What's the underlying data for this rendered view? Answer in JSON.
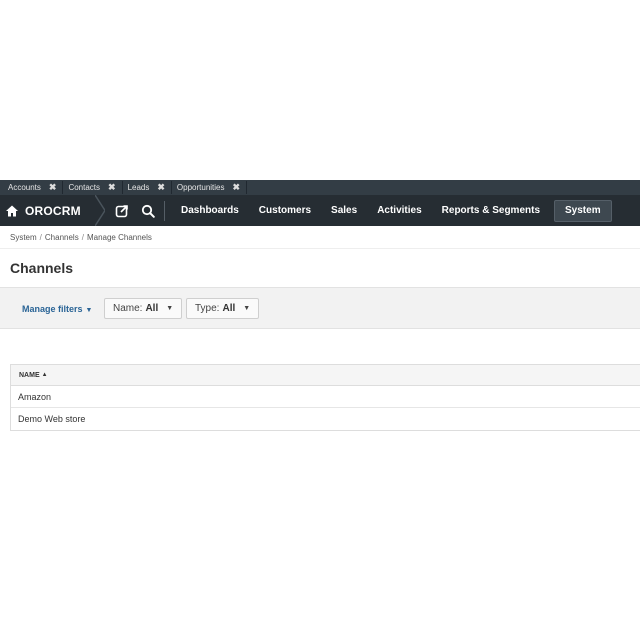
{
  "pinbar": {
    "tabs": [
      {
        "label": "Accounts"
      },
      {
        "label": "Contacts"
      },
      {
        "label": "Leads"
      },
      {
        "label": "Opportunities"
      }
    ],
    "close_glyph": "✖"
  },
  "nav": {
    "brand": "OROCRM",
    "items": [
      {
        "label": "Dashboards"
      },
      {
        "label": "Customers"
      },
      {
        "label": "Sales"
      },
      {
        "label": "Activities"
      },
      {
        "label": "Reports & Segments"
      },
      {
        "label": "System"
      }
    ],
    "active": "System",
    "icons": [
      "home-icon",
      "share-icon",
      "search-icon"
    ]
  },
  "breadcrumb": [
    "System",
    "Channels",
    "Manage Channels"
  ],
  "page_title": "Channels",
  "filters": {
    "manage_label": "Manage filters",
    "name_filter": {
      "label": "Name:",
      "value": "All"
    },
    "type_filter": {
      "label": "Type:",
      "value": "All"
    }
  },
  "grid": {
    "columns": [
      {
        "label": "NAME",
        "sort": "ascending"
      }
    ],
    "rows": [
      {
        "name": "Amazon"
      },
      {
        "name": "Demo Web store"
      }
    ]
  },
  "colors": {
    "nav_bg": "#262d33",
    "pinbar_bg": "#333d45",
    "link_blue": "#2a6496"
  }
}
